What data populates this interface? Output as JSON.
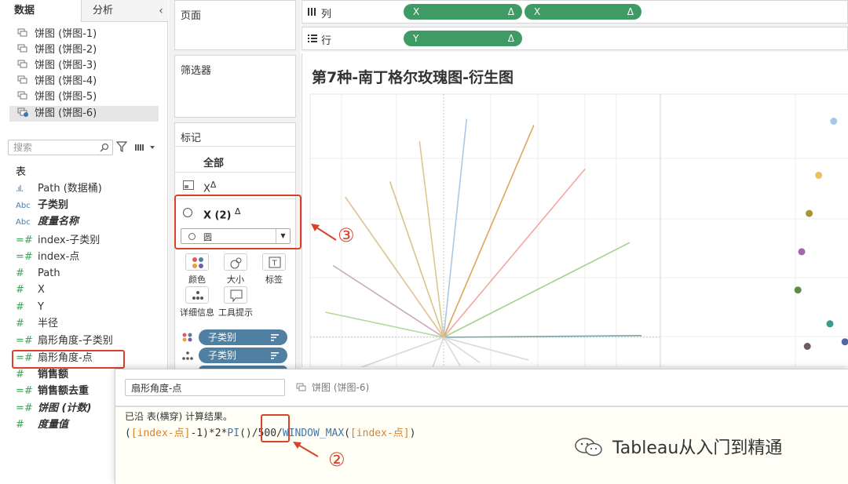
{
  "left_pane": {
    "tabs": [
      "数据",
      "分析"
    ],
    "collapse_glyph": "‹",
    "datasources": [
      "饼图 (饼图-1)",
      "饼图 (饼图-2)",
      "饼图 (饼图-3)",
      "饼图 (饼图-4)",
      "饼图 (饼图-5)",
      "饼图 (饼图-6)"
    ],
    "search_placeholder": "搜索",
    "table_heading": "表",
    "fields": [
      {
        "type": "bars",
        "type_label": ".ıl.",
        "label": "Path (数据桶)"
      },
      {
        "type": "dim",
        "type_label": "Abc",
        "label": "子类别"
      },
      {
        "type": "dim",
        "type_label": "Abc",
        "label": "度量名称",
        "style": "italic"
      },
      {
        "type": "meas",
        "type_label": "=#",
        "label": "index-子类别"
      },
      {
        "type": "meas",
        "type_label": "=#",
        "label": "index-点"
      },
      {
        "type": "meas",
        "type_label": "#",
        "label": "Path"
      },
      {
        "type": "meas",
        "type_label": "#",
        "label": "X"
      },
      {
        "type": "meas",
        "type_label": "#",
        "label": "Y"
      },
      {
        "type": "meas",
        "type_label": "#",
        "label": "半径"
      },
      {
        "type": "meas",
        "type_label": "=#",
        "label": "扇形角度-子类别"
      },
      {
        "type": "meas",
        "type_label": "=#",
        "label": "扇形角度-点"
      },
      {
        "type": "meas",
        "type_label": "#",
        "label": "销售额"
      },
      {
        "type": "meas",
        "type_label": "=#",
        "label": "销售额去重"
      },
      {
        "type": "meas",
        "type_label": "=#",
        "label": "饼图 (计数)",
        "style": "italic"
      },
      {
        "type": "meas",
        "type_label": "#",
        "label": "度量值",
        "style": "italic"
      }
    ]
  },
  "shelves": {
    "pages_title": "页面",
    "filters_title": "筛选器",
    "marks_title": "标记",
    "marks_all": "全部",
    "marks_x": "X",
    "marks_x2": "X (2)",
    "delta": "Δ",
    "mark_type": "圆",
    "buttons": [
      "颜色",
      "大小",
      "标签",
      "详细信息",
      "工具提示"
    ],
    "pills": [
      "子类别",
      "子类别"
    ]
  },
  "columns": {
    "label": "列",
    "pills": [
      "X",
      "X"
    ]
  },
  "rows": {
    "label": "行",
    "pills": [
      "Y"
    ]
  },
  "view": {
    "title": "第7种-南丁格尔玫瑰图-衍生图"
  },
  "annotations": {
    "three": "③",
    "two": "②"
  },
  "calc": {
    "name": "扇形角度-点",
    "source": "饼图 (饼图-6)",
    "note": "已沿 表(横穿) 计算结果。",
    "formula_parts": [
      "(",
      "[index-点]",
      "-1)*2*",
      "PI",
      "()/",
      "500",
      "/",
      "WINDOW_MAX",
      "(",
      "[index-点]",
      ")"
    ]
  },
  "watermark": "Tableau从入门到精通",
  "chart_data": {
    "type": "scatter",
    "title": "第7种-南丁格尔玫瑰图-衍生图",
    "colors": {
      "accent": "#d9412a",
      "pill_blue": "#4f7fa2",
      "pill_green": "#3e9b64"
    },
    "rays": [
      {
        "angle_deg": 84,
        "length": 1.0,
        "color": "#a9c8e8"
      },
      {
        "angle_deg": 67,
        "length": 1.05,
        "color": "#d9a85a"
      },
      {
        "angle_deg": 50,
        "length": 1.0,
        "color": "#f4a6a0"
      },
      {
        "angle_deg": 27,
        "length": 0.95,
        "color": "#a8d08d"
      },
      {
        "angle_deg": 0.5,
        "length": 0.9,
        "color": "#7aa6a6"
      },
      {
        "angle_deg": -15,
        "length": 0.4,
        "color": "#d9d9d9"
      },
      {
        "angle_deg": -35,
        "length": 0.2,
        "color": "#d9d9d9"
      },
      {
        "angle_deg": -60,
        "length": 0.15,
        "color": "#d9d9d9"
      },
      {
        "angle_deg": -110,
        "length": 0.15,
        "color": "#d9d9d9"
      },
      {
        "angle_deg": -160,
        "length": 0.4,
        "color": "#d9d9d9"
      },
      {
        "angle_deg": 168,
        "length": 0.55,
        "color": "#b3d99a"
      },
      {
        "angle_deg": 147,
        "length": 0.6,
        "color": "#c8a9bf"
      },
      {
        "angle_deg": 125,
        "length": 0.78,
        "color": "#e0c38c"
      },
      {
        "angle_deg": 109,
        "length": 0.75,
        "color": "#d8c48a"
      },
      {
        "angle_deg": 97,
        "length": 0.9,
        "color": "#d9c98f"
      }
    ],
    "points": [
      {
        "x": 0.92,
        "y": 0.96,
        "color": "#a9c8e8"
      },
      {
        "x": 0.84,
        "y": 0.72,
        "color": "#e8c25a"
      },
      {
        "x": 0.79,
        "y": 0.55,
        "color": "#a89438"
      },
      {
        "x": 0.75,
        "y": 0.38,
        "color": "#a06aa8"
      },
      {
        "x": 0.73,
        "y": 0.21,
        "color": "#5b8d48"
      },
      {
        "x": 0.9,
        "y": 0.06,
        "color": "#3a9a8f"
      },
      {
        "x": 0.78,
        "y": -0.04,
        "color": "#6e5b5b"
      },
      {
        "x": 0.98,
        "y": -0.02,
        "color": "#4e68a8"
      }
    ]
  }
}
